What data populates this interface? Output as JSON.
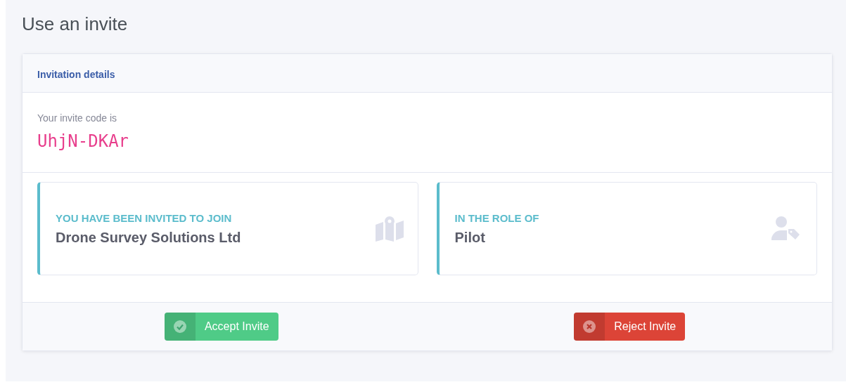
{
  "page_title": "Use an invite",
  "card": {
    "header": "Invitation details",
    "code_label": "Your invite code is",
    "code": "UhjN-DKAr",
    "info_boxes": [
      {
        "label": "YOU HAVE BEEN INVITED TO JOIN",
        "value": "Drone Survey Solutions Ltd",
        "kind": "organisation"
      },
      {
        "label": "IN THE ROLE OF",
        "value": "Pilot",
        "kind": "role"
      }
    ],
    "buttons": [
      {
        "label": "Accept Invite",
        "kind": "success"
      },
      {
        "label": "Reject Invite",
        "kind": "danger"
      }
    ]
  }
}
